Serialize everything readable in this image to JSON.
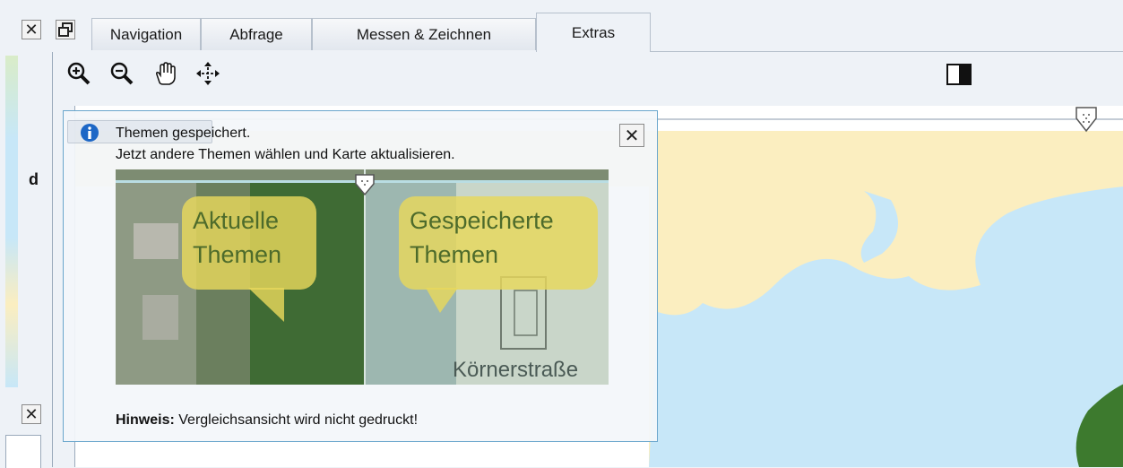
{
  "toolbar": {
    "tabs": [
      {
        "label": "Navigation"
      },
      {
        "label": "Abfrage"
      },
      {
        "label": "Messen & Zeichnen"
      },
      {
        "label": "Extras"
      }
    ]
  },
  "side_panel": {
    "letter": "d"
  },
  "popup": {
    "message_line1": "Themen gespeichert.",
    "message_line2": "Jetzt andere Themen wählen und Karte aktualisieren.",
    "preview": {
      "left_label_line1": "Aktuelle",
      "left_label_line2": "Themen",
      "right_label_line1": "Gespeicherte",
      "right_label_line2": "Themen",
      "street_label": "Körnerstraße"
    },
    "hint_bold": "Hinweis:",
    "hint_text": "Vergleichsansicht wird nicht gedruckt!"
  },
  "colors": {
    "accent_border": "#6aa6cc",
    "map_water": "#c7e7f8",
    "map_land": "#fbeec0",
    "info_icon": "#1d67c6"
  }
}
